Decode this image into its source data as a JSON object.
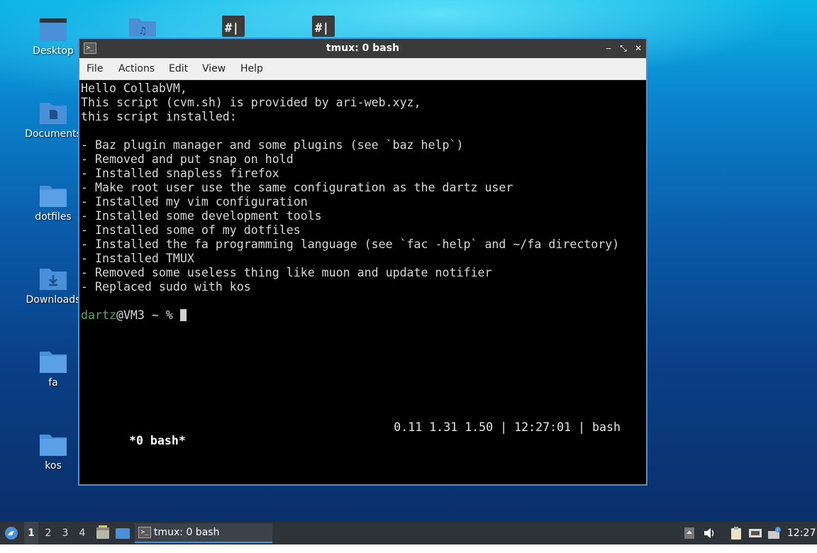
{
  "desktop": {
    "icons": [
      {
        "label": "Desktop"
      },
      {
        "label": "Documents"
      },
      {
        "label": "dotfiles"
      },
      {
        "label": "Downloads"
      },
      {
        "label": "fa"
      },
      {
        "label": "kos"
      }
    ],
    "colors": {
      "folder": "#4a90d9",
      "folder_tab": "#3a78c2"
    }
  },
  "window": {
    "title": "tmux: 0 bash",
    "minimize_glyph": "‒",
    "maximize_glyph": "⤡",
    "close_glyph": "✕",
    "app_icon_glyph": ">_",
    "menu": [
      "File",
      "Actions",
      "Edit",
      "View",
      "Help"
    ],
    "border_color": "#4a90d9"
  },
  "terminal": {
    "lines": [
      "Hello CollabVM,",
      "This script (cvm.sh) is provided by ari-web.xyz,",
      "this script installed:",
      "",
      "- Baz plugin manager and some plugins (see `baz help`)",
      "- Removed and put snap on hold",
      "- Installed snapless firefox",
      "- Make root user use the same configuration as the dartz user",
      "- Installed my vim configuration",
      "- Installed some development tools",
      "- Installed some of my dotfiles",
      "- Installed the fa programming language (see `fac -help` and ~/fa directory)",
      "- Installed TMUX",
      "- Removed some useless thing like muon and update notifier",
      "- Replaced sudo with kos",
      ""
    ],
    "prompt": {
      "user": "dartz",
      "rest": "@VM3 ~ % "
    },
    "statusline": {
      "left": "*0 bash*",
      "right": "0.11 1.31 1.50 | 12:27:01 | bash"
    },
    "colors": {
      "fg": "#d8d8d8",
      "bg": "#000000",
      "user": "#4caf50"
    }
  },
  "taskbar": {
    "workspaces": [
      "1",
      "2",
      "3",
      "4"
    ],
    "active_workspace": "1",
    "task_label": "tmux: 0 bash",
    "clock": "12:27",
    "icons": [
      "start-menu-icon",
      "file-manager-icon",
      "show-desktop-icon",
      "up-arrow-icon",
      "volume-icon",
      "clipboard-icon",
      "network-icon",
      "notification-icon"
    ]
  }
}
